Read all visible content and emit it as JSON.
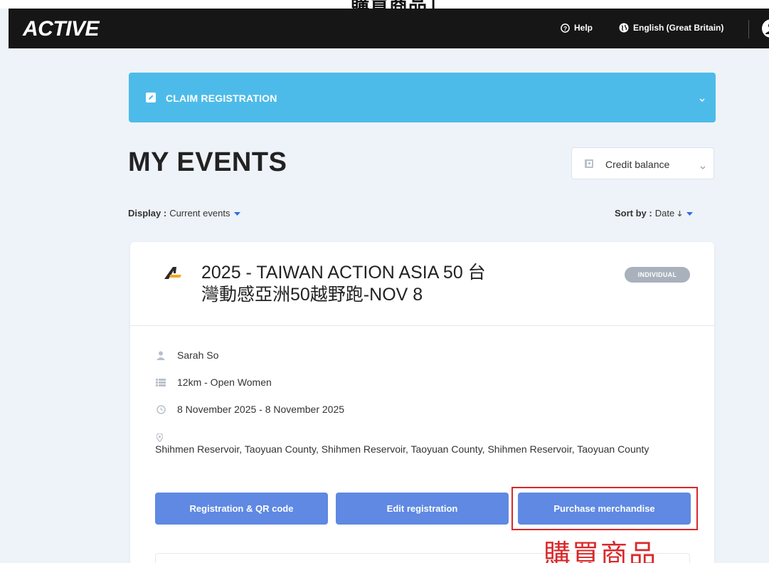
{
  "top_caption": "購買商品」",
  "header": {
    "logo_text": "ACTIVE",
    "help_label": "Help",
    "language_label": "English (Great Britain)"
  },
  "claim": {
    "label": "CLAIM REGISTRATION"
  },
  "page": {
    "title": "MY EVENTS",
    "credit_label": "Credit balance",
    "display_label": "Display :",
    "display_value": "Current events",
    "sort_label": "Sort by :",
    "sort_value": "Date"
  },
  "event": {
    "title_line1": "2025 - TAIWAN ACTION ASIA 50 台",
    "title_line2": "灣動感亞洲50越野跑-NOV 8",
    "badge": "INDIVIDUAL",
    "participant": "Sarah So",
    "race": "12km - Open Women",
    "dates": "8 November 2025 - 8 November 2025",
    "location": "Shihmen Reservoir, Taoyuan County, Shihmen Reservoir, Taoyuan County, Shihmen Reservoir, Taoyuan County",
    "buttons": {
      "registration": "Registration & QR code",
      "edit": "Edit registration",
      "merchandise": "Purchase merchandise"
    }
  },
  "annotation": {
    "text": "購買商品",
    "color": "#d8282a"
  },
  "colors": {
    "header_bg": "#161616",
    "claim_bg": "#4dbbe9",
    "button_bg": "#5f89e2",
    "page_bg": "#eef3f9",
    "badge_bg": "#a9b1bd"
  },
  "icons": {
    "help": "help-circle-icon",
    "language": "globe-icon",
    "user": "user-avatar-icon",
    "claim": "edit-square-icon",
    "credit": "wallet-icon",
    "person": "person-icon",
    "race": "list-icon",
    "date": "clock-icon",
    "location": "map-pin-icon"
  }
}
